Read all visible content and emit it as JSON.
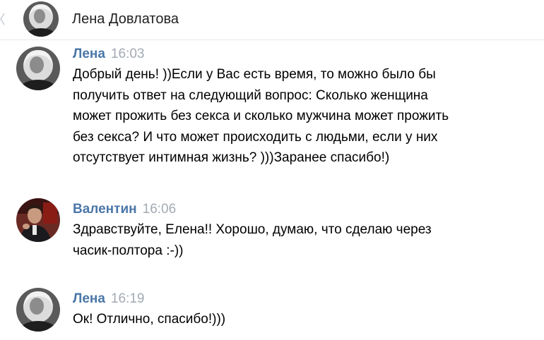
{
  "header": {
    "contact_name": "Лена Довлатова"
  },
  "messages": [
    {
      "author": "Лена",
      "time": "16:03",
      "lines": [
        "Добрый день! ))Если у Вас есть время, то можно было бы",
        "получить ответ на следующий вопрос: Сколько женщина",
        "может прожить без секса и сколько мужчина может прожить",
        "без секса? И что может происходить с людьми, если у них",
        "отсутствует интимная жизнь? )))Заранее спасибо!)"
      ]
    },
    {
      "author": "Валентин",
      "time": "16:06",
      "lines": [
        "Здравствуйте, Елена!! Хорошо, думаю, что сделаю через",
        "часик-полтора :-))"
      ]
    },
    {
      "author": "Лена",
      "time": "16:19",
      "lines": [
        "Ок! Отлично, спасибо!)))"
      ]
    }
  ],
  "colors": {
    "author": "#4a76a8",
    "time": "#a3aab3",
    "text": "#000000"
  },
  "icons": {
    "back": "chevron-left-icon"
  }
}
